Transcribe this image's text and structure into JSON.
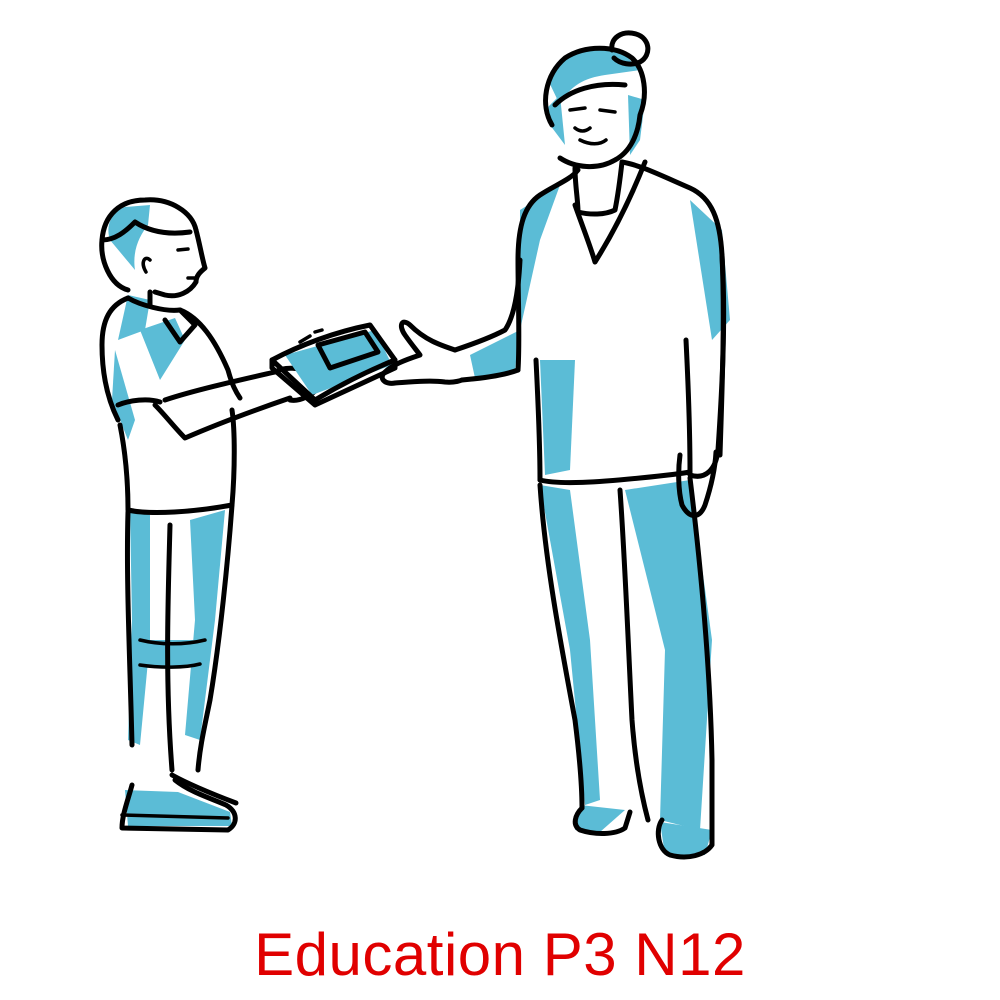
{
  "caption": {
    "text": "Education P3 N12",
    "color": "#e00000"
  },
  "palette": {
    "outline": "#000000",
    "shade": "#5bbcd6",
    "background": "#ffffff"
  },
  "figures": [
    {
      "name": "boy",
      "icon": "boy-figure"
    },
    {
      "name": "woman",
      "icon": "older-woman-figure"
    },
    {
      "name": "book",
      "icon": "book-icon"
    }
  ]
}
